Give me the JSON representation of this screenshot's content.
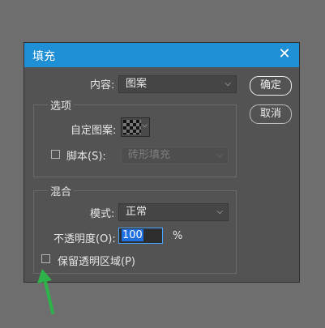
{
  "dialog": {
    "title": "填充",
    "close_glyph": "✕"
  },
  "content_row": {
    "label": "内容:",
    "value": "图案"
  },
  "options_group": {
    "legend": "选项",
    "custom_pattern_label": "自定图案:",
    "script_label": "脚本(S):",
    "script_value": "砖形填充",
    "script_checked": false
  },
  "blend_group": {
    "legend": "混合",
    "mode_label": "模式:",
    "mode_value": "正常",
    "opacity_label": "不透明度(O):",
    "opacity_value": "100",
    "opacity_unit": "%",
    "preserve_transparency_label": "保留透明区域(P)",
    "preserve_transparency_checked": false
  },
  "buttons": {
    "ok": "确定",
    "cancel": "取消"
  },
  "icons": {
    "dropdown": "chevron-down-icon",
    "close": "close-icon",
    "annotation": "arrow-up-icon"
  },
  "colors": {
    "titlebar": "#1f8fd6",
    "panel": "#535353",
    "annotation_arrow": "#2db34a"
  }
}
